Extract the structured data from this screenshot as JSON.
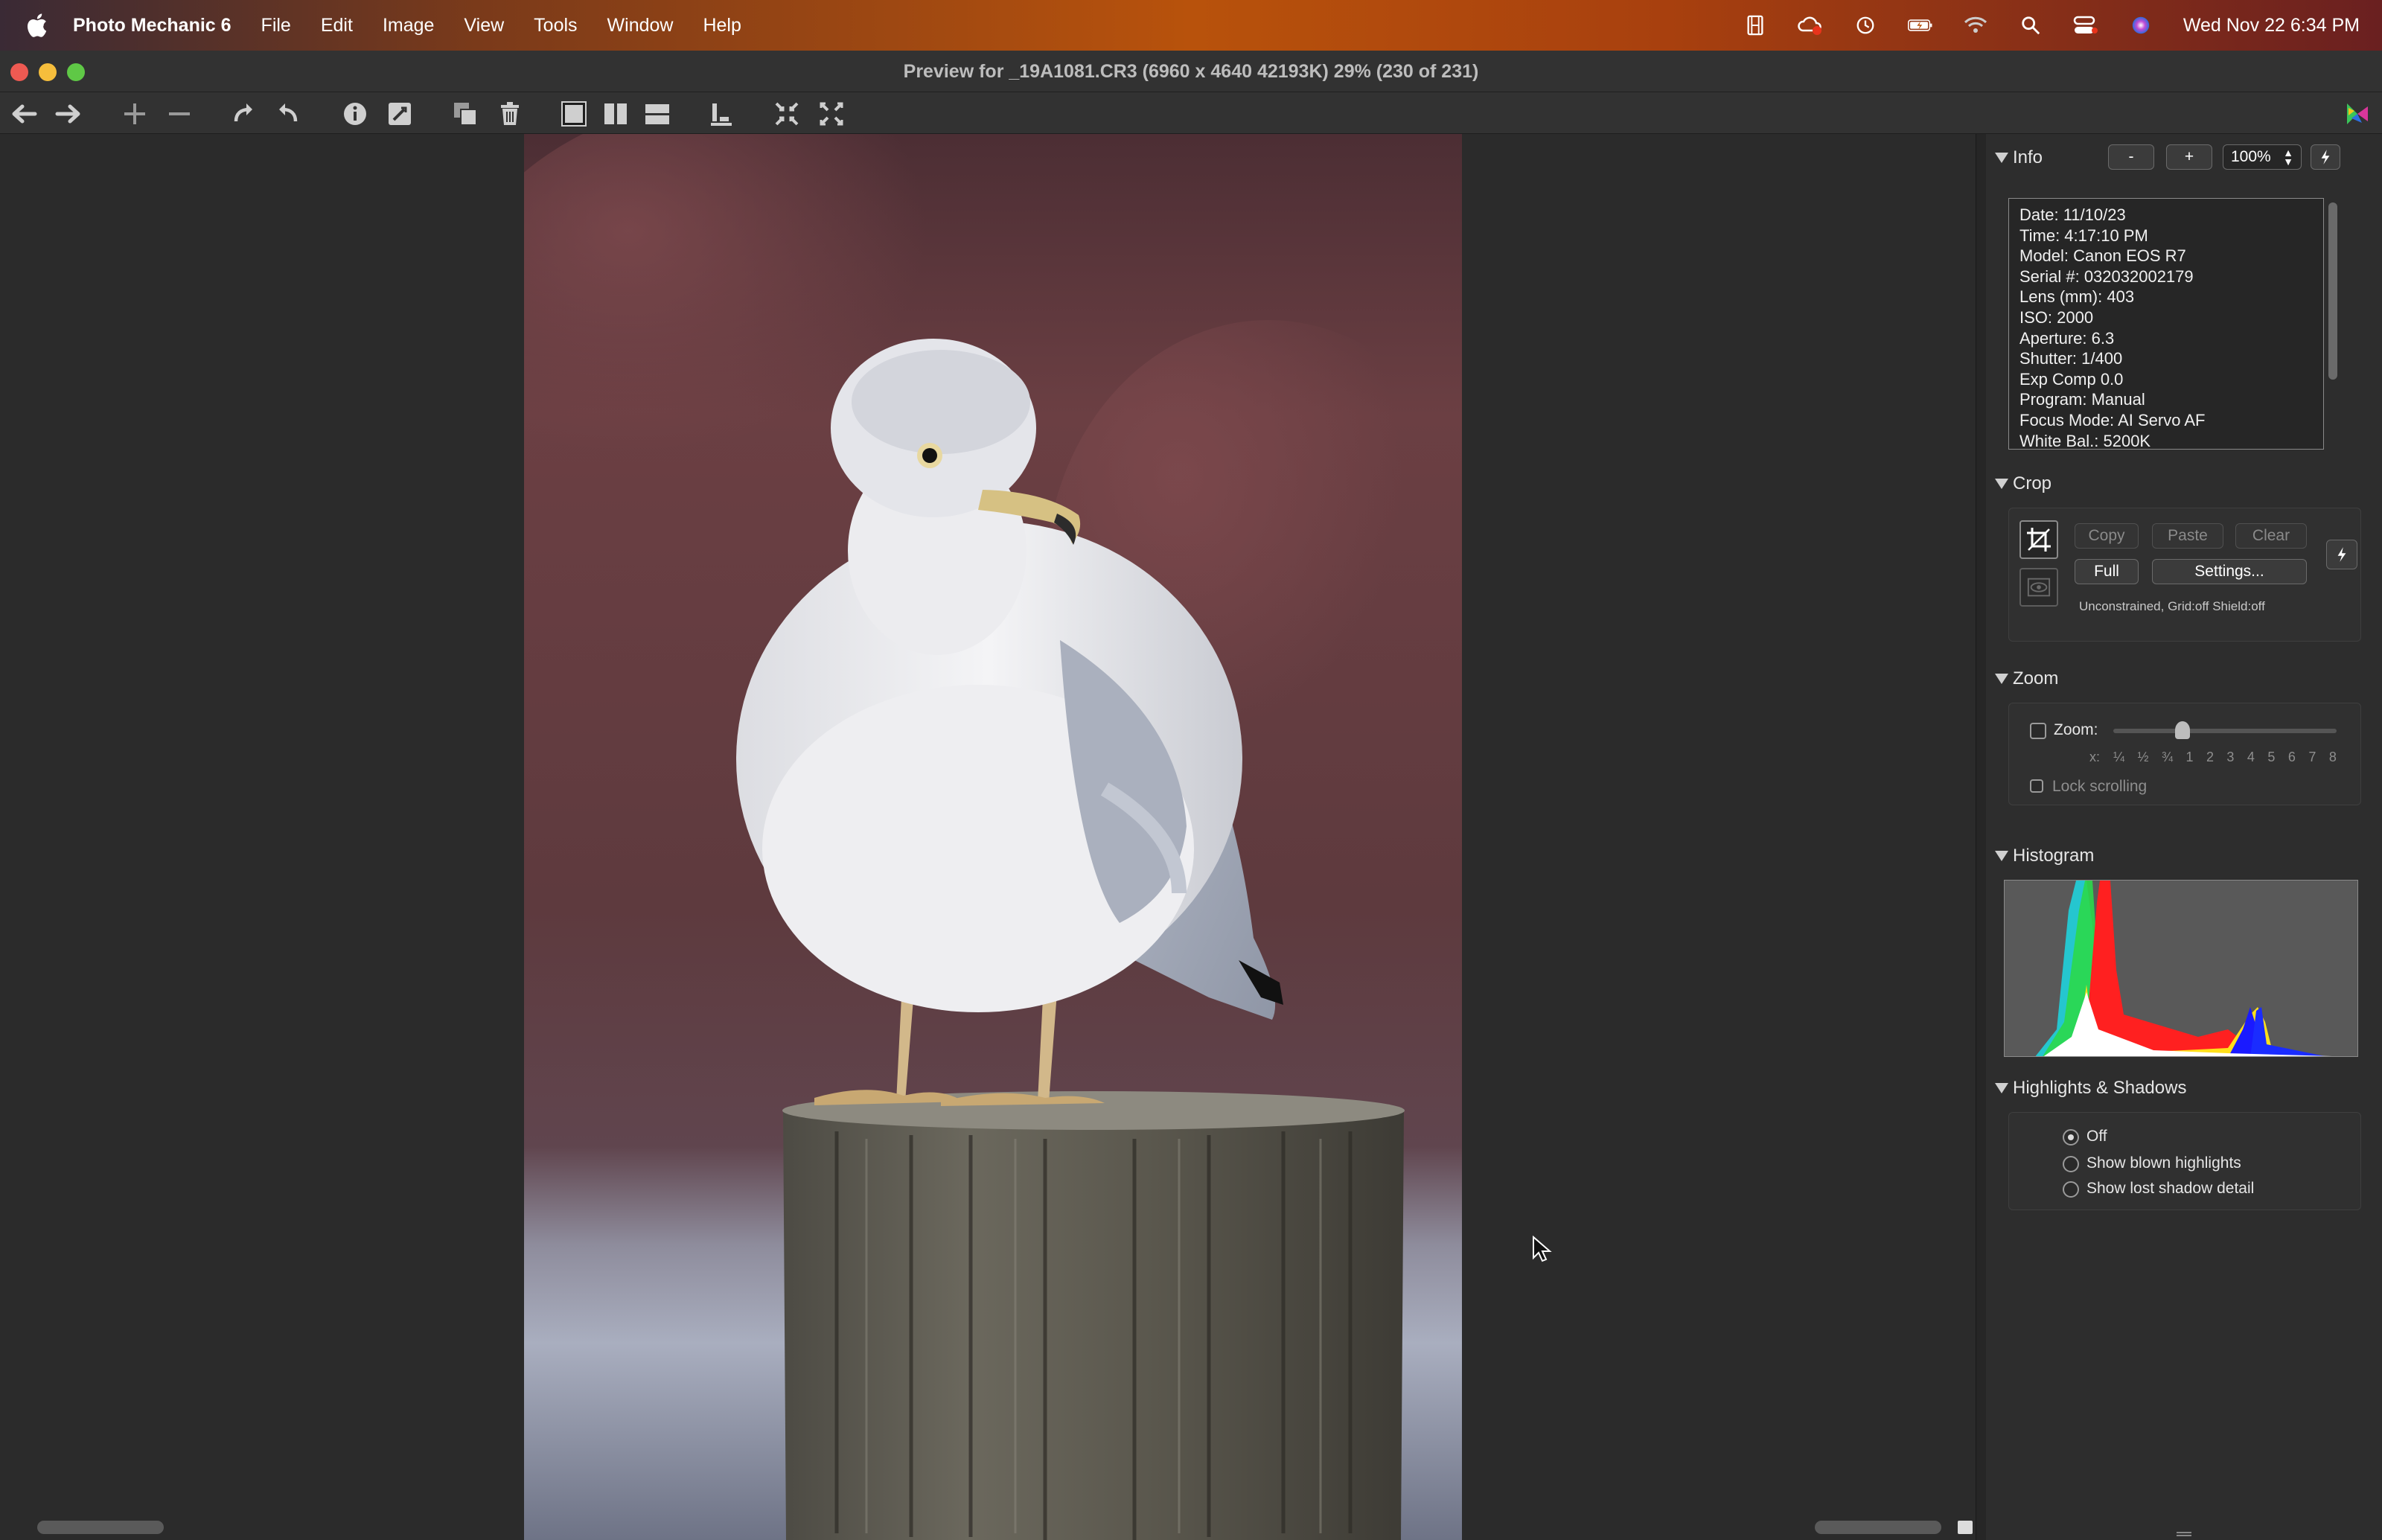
{
  "menubar": {
    "app_name": "Photo Mechanic 6",
    "items": [
      "File",
      "Edit",
      "Image",
      "View",
      "Tools",
      "Window",
      "Help"
    ],
    "clock": "Wed Nov 22  6:34 PM"
  },
  "window": {
    "title": "Preview for _19A1081.CR3 (6960 x 4640 42193K) 29% (230 of 231)"
  },
  "panel": {
    "info": {
      "heading": "Info",
      "minus_label": "-",
      "plus_label": "+",
      "zoom_value": "100%",
      "lines": [
        "Date: 11/10/23",
        "Time: 4:17:10 PM",
        "Model: Canon EOS R7",
        "Serial #: 032032002179",
        "Lens (mm): 403",
        "ISO: 2000",
        "Aperture: 6.3",
        "Shutter: 1/400",
        "Exp Comp 0.0",
        "Program: Manual",
        "Focus Mode: AI Servo AF",
        "White Bal.: 5200K"
      ]
    },
    "crop": {
      "heading": "Crop",
      "copy_label": "Copy",
      "paste_label": "Paste",
      "clear_label": "Clear",
      "full_label": "Full",
      "settings_label": "Settings...",
      "status": "Unconstrained, Grid:off Shield:off"
    },
    "zoom": {
      "heading": "Zoom",
      "zoom_label": "Zoom:",
      "scale_prefix": "x:",
      "scale_ticks": [
        "¼",
        "½",
        "¾",
        "1",
        "2",
        "3",
        "4",
        "5",
        "6",
        "7",
        "8"
      ],
      "lock_label": "Lock scrolling",
      "slider_position": 0.31
    },
    "histogram": {
      "heading": "Histogram"
    },
    "highlights": {
      "heading": "Highlights & Shadows",
      "options": [
        "Off",
        "Show blown highlights",
        "Show lost shadow detail"
      ],
      "selected": 0
    }
  },
  "colors": {
    "panel_bg": "#2d2d2d",
    "canvas_bg": "#2b2b2b",
    "photo_bg_top": "#6a3f42",
    "photo_bg_bottom": "#a9b0c0"
  }
}
